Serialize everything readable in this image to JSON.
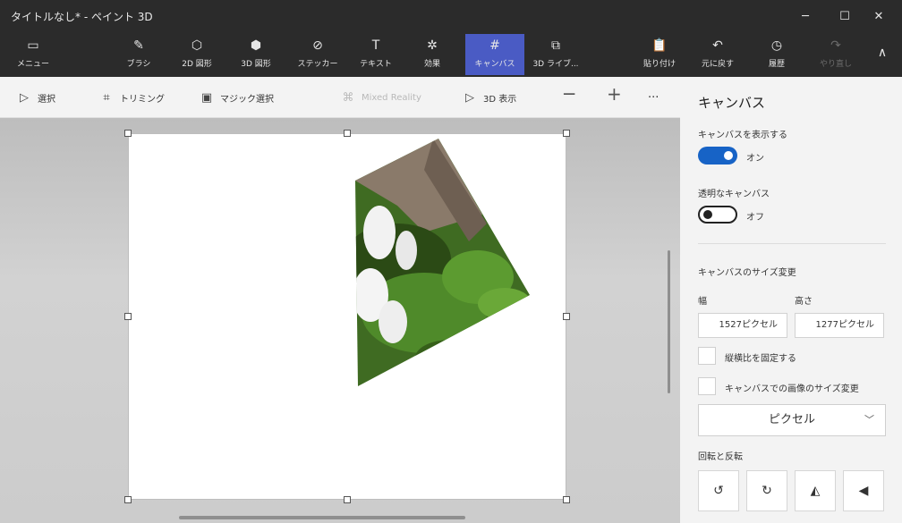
{
  "window": {
    "title": "タイトルなし* - ペイント 3D",
    "minimize_glyph": "─",
    "maximize_glyph": "☐",
    "close_glyph": "✕"
  },
  "ribbon": {
    "menu": {
      "label": "メニュー",
      "icon": "folder-icon",
      "glyph": "▭"
    },
    "brush": {
      "label": "ブラシ",
      "icon": "brush-icon",
      "glyph": "✎"
    },
    "shapes2d": {
      "label": "2D 図形",
      "icon": "2d-shapes-icon",
      "glyph": "⬡"
    },
    "shapes3d": {
      "label": "3D 図形",
      "icon": "3d-shapes-icon",
      "glyph": "⬢"
    },
    "stickers": {
      "label": "ステッカー",
      "icon": "sticker-icon",
      "glyph": "⊘"
    },
    "text": {
      "label": "テキスト",
      "icon": "text-icon",
      "glyph": "T"
    },
    "effects": {
      "label": "効果",
      "icon": "effects-icon",
      "glyph": "✲"
    },
    "canvas": {
      "label": "キャンバス",
      "icon": "canvas-icon",
      "glyph": "#"
    },
    "library3d": {
      "label": "3D ライブ...",
      "icon": "3d-library-icon",
      "glyph": "⧉"
    },
    "paste": {
      "label": "貼り付け",
      "icon": "paste-icon",
      "glyph": "📋"
    },
    "undo": {
      "label": "元に戻す",
      "icon": "undo-icon",
      "glyph": "↶"
    },
    "history": {
      "label": "履歴",
      "icon": "history-icon",
      "glyph": "◷"
    },
    "redo": {
      "label": "やり直し",
      "icon": "redo-icon",
      "glyph": "↷"
    },
    "collapse_glyph": "∧",
    "accent": "#4a5bc4"
  },
  "toolbar": {
    "select": {
      "label": "選択",
      "glyph": "▷"
    },
    "crop": {
      "label": "トリミング",
      "glyph": "⌗"
    },
    "magic_select": {
      "label": "マジック選択",
      "glyph": "▣"
    },
    "mixed_reality": {
      "label": "Mixed Reality",
      "glyph": "⌘"
    },
    "view3d": {
      "label": "3D 表示",
      "glyph": "▷"
    },
    "zoom_out": "─",
    "zoom_in": "+",
    "more": "···"
  },
  "panel": {
    "title": "キャンバス",
    "show_canvas": {
      "label": "キャンバスを表示する",
      "state": "オン"
    },
    "transparent_canvas": {
      "label": "透明なキャンバス",
      "state": "オフ"
    },
    "resize_title": "キャンバスのサイズ変更",
    "width_label": "幅",
    "height_label": "高さ",
    "width_value": "1527ピクセル",
    "height_value": "1277ピクセル",
    "lock_aspect": "縦横比を固定する",
    "resize_image": "キャンバスでの画像のサイズ変更",
    "unit": "ピクセル",
    "unit_chevron": "﹀",
    "rotate_flip": "回転と反転",
    "rotate_left": "↺",
    "rotate_right": "↻",
    "flip_horizontal": "◭",
    "flip_vertical": "◀"
  }
}
